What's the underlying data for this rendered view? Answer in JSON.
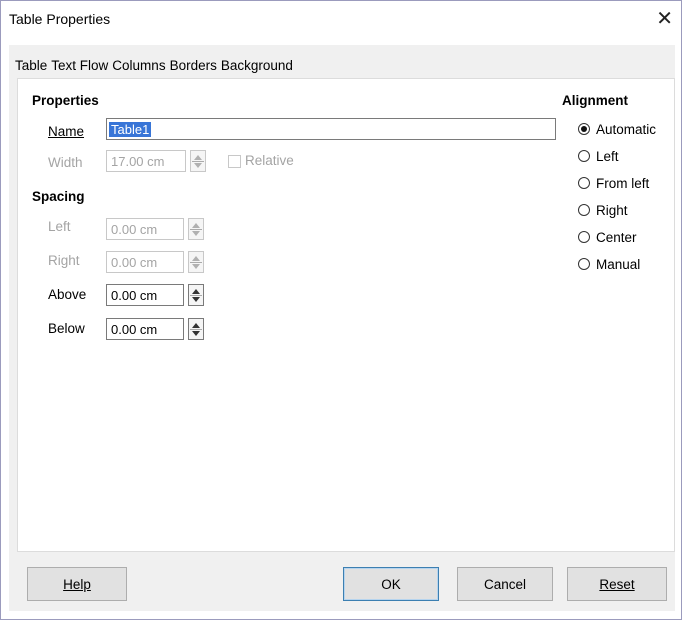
{
  "window": {
    "title": "Table Properties",
    "close_glyph": "✕"
  },
  "tabs": [
    "Table",
    "Text Flow",
    "Columns",
    "Borders",
    "Background"
  ],
  "properties": {
    "heading": "Properties",
    "name_label": "Name",
    "name_value": "Table1",
    "width_label": "Width",
    "width_value": "17.00 cm",
    "relative_label": "Relative"
  },
  "spacing": {
    "heading": "Spacing",
    "left_label": "Left",
    "left_value": "0.00 cm",
    "right_label": "Right",
    "right_value": "0.00 cm",
    "above_label": "Above",
    "above_value": "0.00 cm",
    "below_label": "Below",
    "below_value": "0.00 cm"
  },
  "alignment": {
    "heading": "Alignment",
    "options": [
      "Automatic",
      "Left",
      "From left",
      "Right",
      "Center",
      "Manual"
    ],
    "selected": "Automatic"
  },
  "buttons": {
    "help": "Help",
    "ok": "OK",
    "cancel": "Cancel",
    "reset": "Reset"
  }
}
